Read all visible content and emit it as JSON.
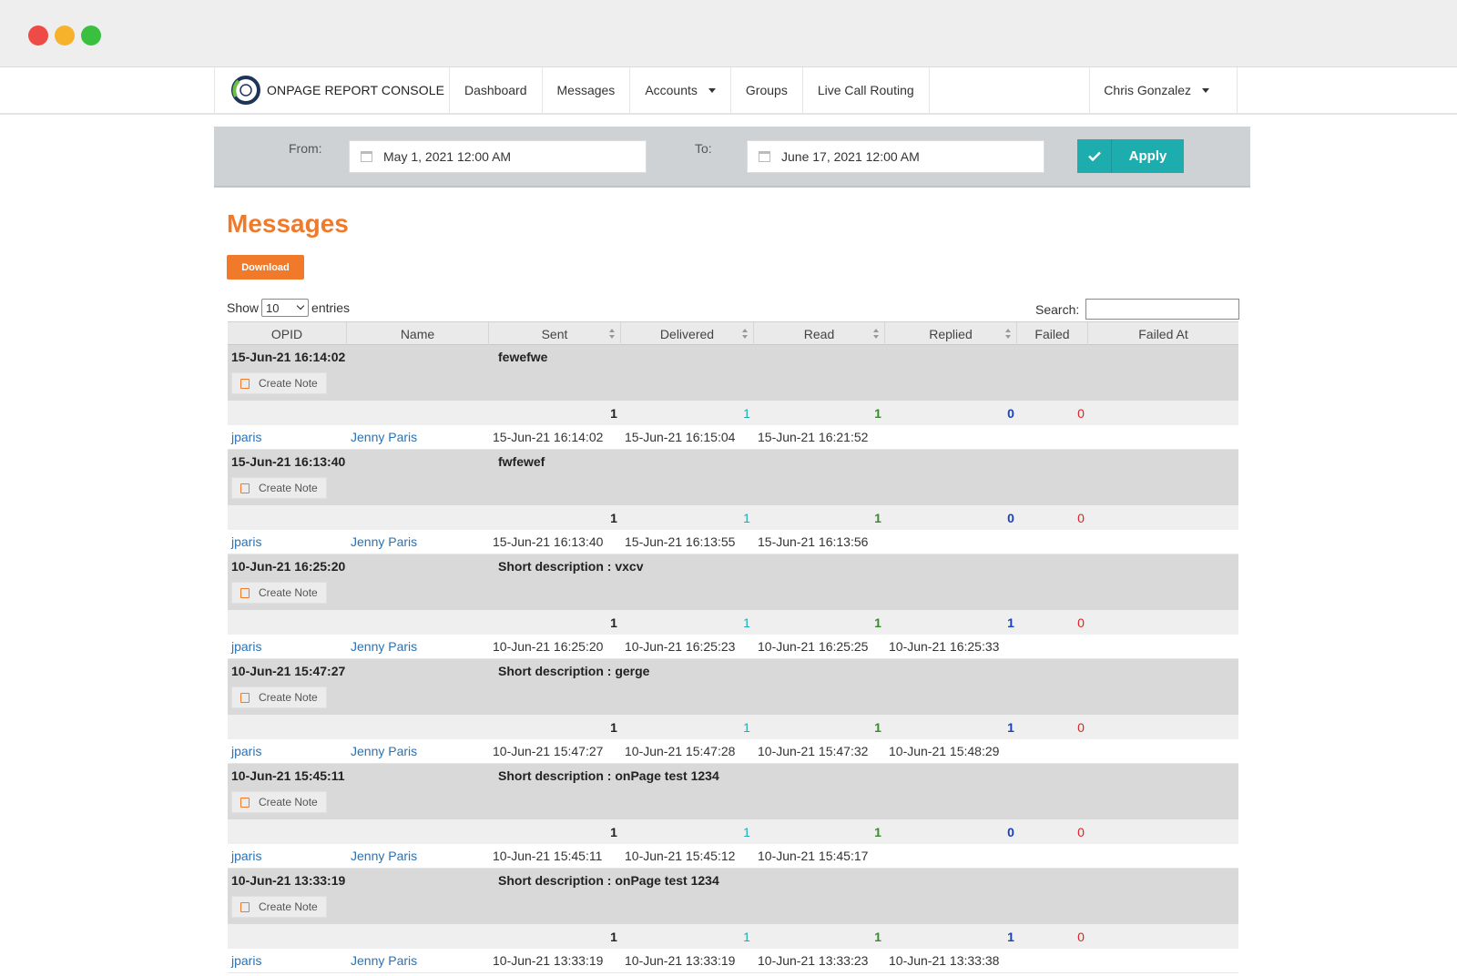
{
  "brand": {
    "name": "ONPAGE REPORT CONSOLE"
  },
  "nav": {
    "items": [
      {
        "label": "Dashboard"
      },
      {
        "label": "Messages"
      },
      {
        "label": "Accounts"
      },
      {
        "label": "Groups"
      },
      {
        "label": "Live Call Routing"
      }
    ],
    "user": "Chris Gonzalez"
  },
  "filter": {
    "from_label": "From:",
    "from_value": "May 1, 2021 12:00 AM",
    "to_label": "To:",
    "to_value": "June 17, 2021 12:00 AM",
    "apply_label": "Apply"
  },
  "page": {
    "title": "Messages",
    "download_label": "Download",
    "show_label": "Show",
    "show_value": "10",
    "entries_label": "entries",
    "search_label": "Search:"
  },
  "table": {
    "columns": [
      "OPID",
      "Name",
      "Sent",
      "Delivered",
      "Read",
      "Replied",
      "Failed",
      "Failed At"
    ],
    "create_note_label": "Create Note",
    "groups": [
      {
        "timestamp": "15-Jun-21 16:14:02",
        "message": "fewefwe",
        "counts": {
          "sent": "1",
          "delivered": "1",
          "read": "1",
          "replied": "0",
          "failed": "0"
        },
        "opid": "jparis",
        "name": "Jenny Paris",
        "sent": "15-Jun-21 16:14:02",
        "delivered": "15-Jun-21 16:15:04",
        "read": "15-Jun-21 16:21:52",
        "replied": ""
      },
      {
        "timestamp": "15-Jun-21 16:13:40",
        "message": "fwfewef",
        "counts": {
          "sent": "1",
          "delivered": "1",
          "read": "1",
          "replied": "0",
          "failed": "0"
        },
        "opid": "jparis",
        "name": "Jenny Paris",
        "sent": "15-Jun-21 16:13:40",
        "delivered": "15-Jun-21 16:13:55",
        "read": "15-Jun-21 16:13:56",
        "replied": ""
      },
      {
        "timestamp": "10-Jun-21 16:25:20",
        "message": "Short description : vxcv",
        "counts": {
          "sent": "1",
          "delivered": "1",
          "read": "1",
          "replied": "1",
          "failed": "0"
        },
        "opid": "jparis",
        "name": "Jenny Paris",
        "sent": "10-Jun-21 16:25:20",
        "delivered": "10-Jun-21 16:25:23",
        "read": "10-Jun-21 16:25:25",
        "replied": "10-Jun-21 16:25:33"
      },
      {
        "timestamp": "10-Jun-21 15:47:27",
        "message": "Short description : gerge",
        "counts": {
          "sent": "1",
          "delivered": "1",
          "read": "1",
          "replied": "1",
          "failed": "0"
        },
        "opid": "jparis",
        "name": "Jenny Paris",
        "sent": "10-Jun-21 15:47:27",
        "delivered": "10-Jun-21 15:47:28",
        "read": "10-Jun-21 15:47:32",
        "replied": "10-Jun-21 15:48:29"
      },
      {
        "timestamp": "10-Jun-21 15:45:11",
        "message": "Short description : onPage test 1234",
        "counts": {
          "sent": "1",
          "delivered": "1",
          "read": "1",
          "replied": "0",
          "failed": "0"
        },
        "opid": "jparis",
        "name": "Jenny Paris",
        "sent": "10-Jun-21 15:45:11",
        "delivered": "10-Jun-21 15:45:12",
        "read": "10-Jun-21 15:45:17",
        "replied": ""
      },
      {
        "timestamp": "10-Jun-21 13:33:19",
        "message": "Short description : onPage test 1234",
        "counts": {
          "sent": "1",
          "delivered": "1",
          "read": "1",
          "replied": "1",
          "failed": "0"
        },
        "opid": "jparis",
        "name": "Jenny Paris",
        "sent": "10-Jun-21 13:33:19",
        "delivered": "10-Jun-21 13:33:19",
        "read": "10-Jun-21 13:33:23",
        "replied": "10-Jun-21 13:33:38"
      }
    ]
  },
  "colors": {
    "accent": "#f07a2a",
    "apply": "#1eadae",
    "link": "#2a72b5",
    "delivered": "#1eadae",
    "read": "#3a8a2e",
    "replied": "#1a3fbf",
    "failed": "#dd2222"
  }
}
